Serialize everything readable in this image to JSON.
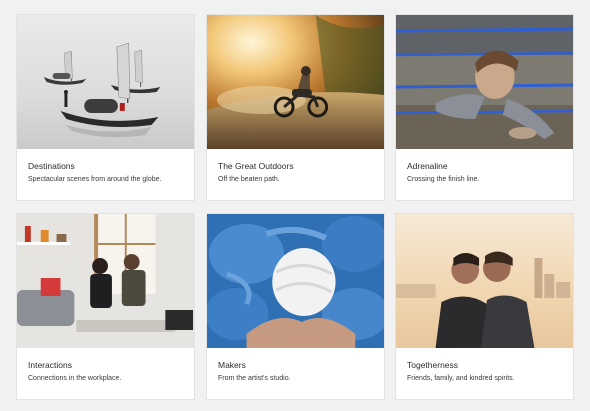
{
  "collections": [
    {
      "title": "Destinations",
      "subtitle": "Spectacular scenes from around the globe.",
      "image": "boats-on-misty-lake-image"
    },
    {
      "title": "The Great Outdoors",
      "subtitle": "Off the beaten path.",
      "image": "motorcyclist-on-dirt-road-image"
    },
    {
      "title": "Adrenaline",
      "subtitle": "Crossing the finish line.",
      "image": "runner-crawling-in-mud-image"
    },
    {
      "title": "Interactions",
      "subtitle": "Connections in the workplace.",
      "image": "people-meeting-in-office-image"
    },
    {
      "title": "Makers",
      "subtitle": "From the artist's studio.",
      "image": "hands-holding-yarn-image"
    },
    {
      "title": "Togetherness",
      "subtitle": "Friends, family, and kindred spirits.",
      "image": "couple-kissing-at-sunset-image"
    }
  ],
  "colors": {
    "page_background": "#f1f1f1",
    "card_background": "#ffffff",
    "title_text": "#2c2c2c",
    "subtitle_text": "#3a3a3a"
  }
}
